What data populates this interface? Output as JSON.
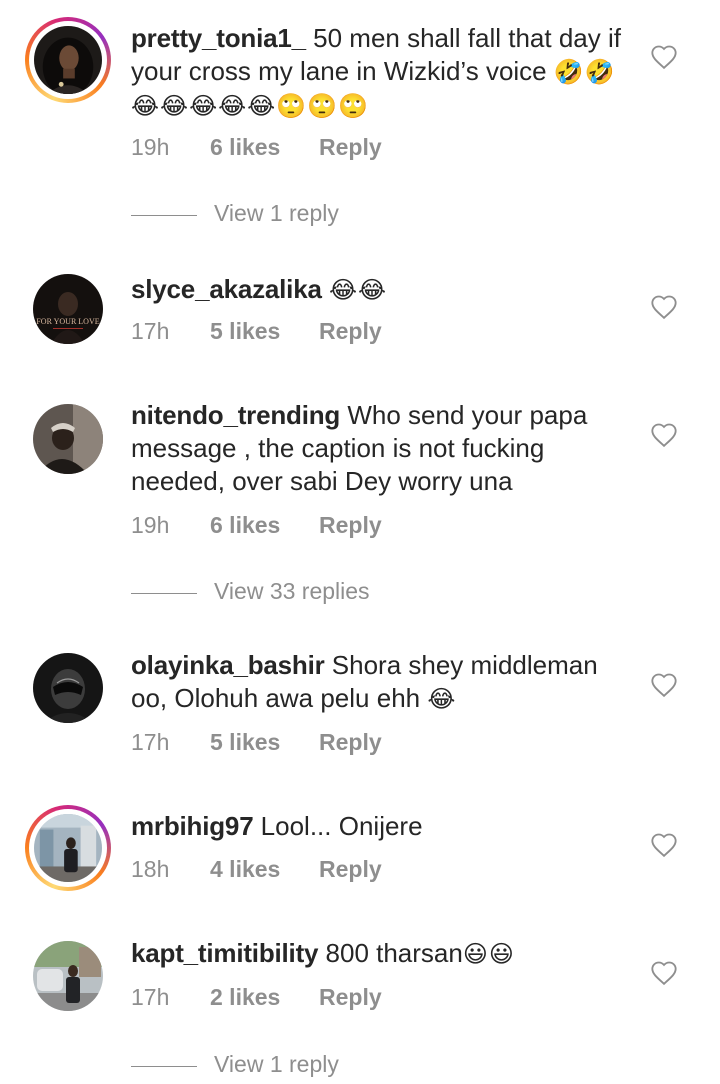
{
  "comments": [
    {
      "username": "pretty_tonia1_",
      "text": " 50 men shall fall that day if your cross my lane in Wizkid’s voice ",
      "emoji": "🤣🤣😂😂😂😂😂🙄🙄🙄",
      "time": "19h",
      "likes": "6 likes",
      "reply": "Reply",
      "view_replies": "View 1 reply"
    },
    {
      "username": "slyce_akazalika",
      "text": " ",
      "emoji": "😂😂",
      "avatar_text": "FOR YOUR LOVE",
      "time": "17h",
      "likes": "5 likes",
      "reply": "Reply"
    },
    {
      "username": "nitendo_trending",
      "text": " Who send your papa message , the caption is not fucking needed, over sabi Dey worry una",
      "time": "19h",
      "likes": "6 likes",
      "reply": "Reply",
      "view_replies": "View 33 replies"
    },
    {
      "username": "olayinka_bashir",
      "text": " Shora shey middleman oo, Olohuh awa pelu ehh ",
      "emoji": "😂",
      "time": "17h",
      "likes": "5 likes",
      "reply": "Reply"
    },
    {
      "username": "mrbihig97",
      "text": " Lool... Onijere",
      "time": "18h",
      "likes": "4 likes",
      "reply": "Reply"
    },
    {
      "username": "kapt_timitibility",
      "text": " 800 tharsan",
      "emoji": "😃😃",
      "time": "17h",
      "likes": "2 likes",
      "reply": "Reply",
      "view_replies": "View 1 reply"
    }
  ],
  "icons": {
    "like": "heart-outline-icon"
  },
  "colors": {
    "text": "#262626",
    "secondary": "#8e8e8e",
    "background": "#ffffff"
  }
}
